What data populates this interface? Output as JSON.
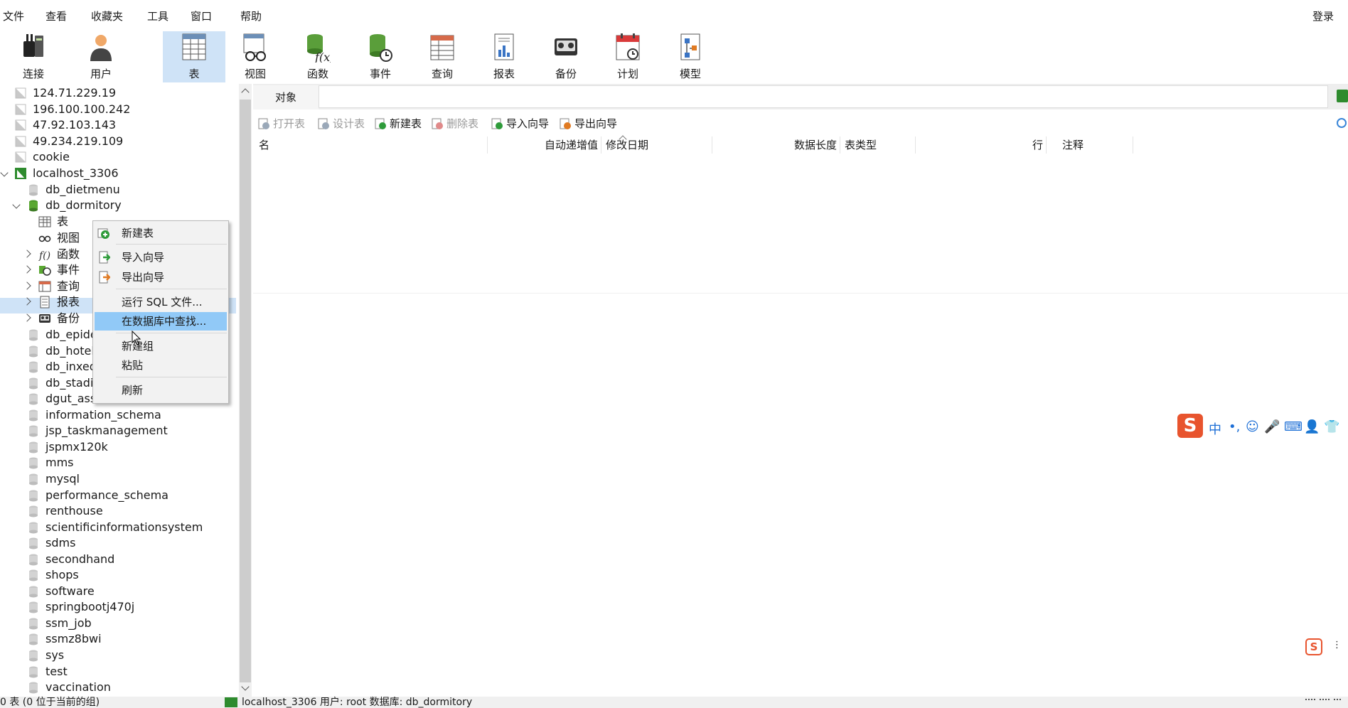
{
  "menu": [
    "文件",
    "查看",
    "收藏夹",
    "工具",
    "窗口",
    "帮助"
  ],
  "login_label": "登录",
  "toolbar": [
    {
      "label": "连接",
      "icon": "connection-icon"
    },
    {
      "label": "用户",
      "icon": "user-icon"
    },
    {
      "label": "表",
      "icon": "table-icon",
      "active": true
    },
    {
      "label": "视图",
      "icon": "view-icon"
    },
    {
      "label": "函数",
      "icon": "function-icon"
    },
    {
      "label": "事件",
      "icon": "event-icon"
    },
    {
      "label": "查询",
      "icon": "query-icon"
    },
    {
      "label": "报表",
      "icon": "report-icon"
    },
    {
      "label": "备份",
      "icon": "backup-icon"
    },
    {
      "label": "计划",
      "icon": "schedule-icon"
    },
    {
      "label": "模型",
      "icon": "model-icon"
    }
  ],
  "tree": {
    "connections": [
      "124.71.229.19",
      "196.100.100.242",
      "47.92.103.143",
      "49.234.219.109",
      "cookie"
    ],
    "active_connection": "localhost_3306",
    "db_dietmenu": "db_dietmenu",
    "db_dormitory": "db_dormitory",
    "children": [
      {
        "label": "表",
        "icon": "table-icon"
      },
      {
        "label": "视图",
        "icon": "view-icon"
      },
      {
        "label": "函数",
        "icon": "function-icon"
      },
      {
        "label": "事件",
        "icon": "event-icon"
      },
      {
        "label": "查询",
        "icon": "query-icon"
      },
      {
        "label": "报表",
        "icon": "report-icon"
      },
      {
        "label": "备份",
        "icon": "backup-icon"
      }
    ],
    "databases": [
      "db_epide",
      "db_hotel",
      "db_inxed",
      "db_stadiu",
      "dgut_ass",
      "information_schema",
      "jsp_taskmanagement",
      "jspmx120k",
      "mms",
      "mysql",
      "performance_schema",
      "renthouse",
      "scientificinformationsystem",
      "sdms",
      "secondhand",
      "shops",
      "software",
      "springbootj470j",
      "ssm_job",
      "ssmz8bwi",
      "sys",
      "test",
      "vaccination"
    ]
  },
  "tab": {
    "label": "对象"
  },
  "subtoolbar": [
    {
      "label": "打开表",
      "disabled": true,
      "icon": "open-table-icon",
      "color": "#9aa8b8"
    },
    {
      "label": "设计表",
      "disabled": true,
      "icon": "design-table-icon",
      "color": "#9aa8b8"
    },
    {
      "label": "新建表",
      "disabled": false,
      "icon": "new-table-icon",
      "color": "#2e9b3a"
    },
    {
      "label": "删除表",
      "disabled": true,
      "icon": "delete-table-icon",
      "color": "#e08a8a"
    },
    {
      "label": "导入向导",
      "disabled": false,
      "icon": "import-wizard-icon",
      "color": "#2e9b3a"
    },
    {
      "label": "导出向导",
      "disabled": false,
      "icon": "export-wizard-icon",
      "color": "#e07a22"
    }
  ],
  "columns": [
    "名",
    "自动递增值",
    "修改日期",
    "数据长度",
    "表类型",
    "行",
    "注释"
  ],
  "context_menu": {
    "items": [
      {
        "label": "新建表",
        "icon": "new-table-icon"
      },
      {
        "label": "导入向导",
        "icon": "import-wizard-icon"
      },
      {
        "label": "导出向导",
        "icon": "export-wizard-icon"
      },
      {
        "label": "运行 SQL 文件...",
        "icon": ""
      },
      {
        "label": "在数据库中查找...",
        "icon": "",
        "highlighted": true
      },
      {
        "label": "新建组",
        "icon": ""
      },
      {
        "label": "粘贴",
        "icon": ""
      },
      {
        "label": "刷新",
        "icon": ""
      }
    ]
  },
  "ime": {
    "logo": "S",
    "items": [
      "中",
      "•,",
      "☺",
      "🎤",
      "⌨",
      "👤",
      "👕"
    ]
  },
  "status": {
    "left": "0 表 (0 位于当前的组)",
    "right": "localhost_3306   用户: root   数据库: db_dormitory"
  },
  "colors": {
    "accent": "#cfe3f7",
    "highlight": "#91c9f7",
    "green": "#2e8b2e"
  }
}
